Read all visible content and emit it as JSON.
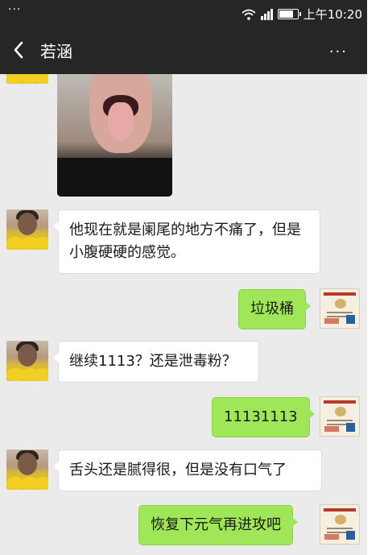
{
  "status_bar": {
    "dots": "···",
    "time": "上午10:20"
  },
  "header": {
    "title": "若涵",
    "back_icon": "chevron-left-icon",
    "more_icon": "more-horizontal-icon",
    "more_label": "···"
  },
  "messages": [
    {
      "side": "left",
      "type": "image",
      "description": ""
    },
    {
      "side": "left",
      "type": "text",
      "text": "他现在就是阑尾的地方不痛了，但是小腹硬硬的感觉。"
    },
    {
      "side": "right",
      "type": "text",
      "text": "垃圾桶"
    },
    {
      "side": "left",
      "type": "text",
      "text": "继续1113？还是泄毒粉？"
    },
    {
      "side": "right",
      "type": "text",
      "text": "11131113"
    },
    {
      "side": "left",
      "type": "text",
      "text": "舌头还是腻得很，但是没有口气了"
    },
    {
      "side": "right",
      "type": "text",
      "text": "恢复下元气再进攻吧"
    }
  ],
  "colors": {
    "header_bg": "#262626",
    "chat_bg": "#ebebeb",
    "sent_bubble": "#9fe658",
    "received_bubble": "#ffffff"
  }
}
